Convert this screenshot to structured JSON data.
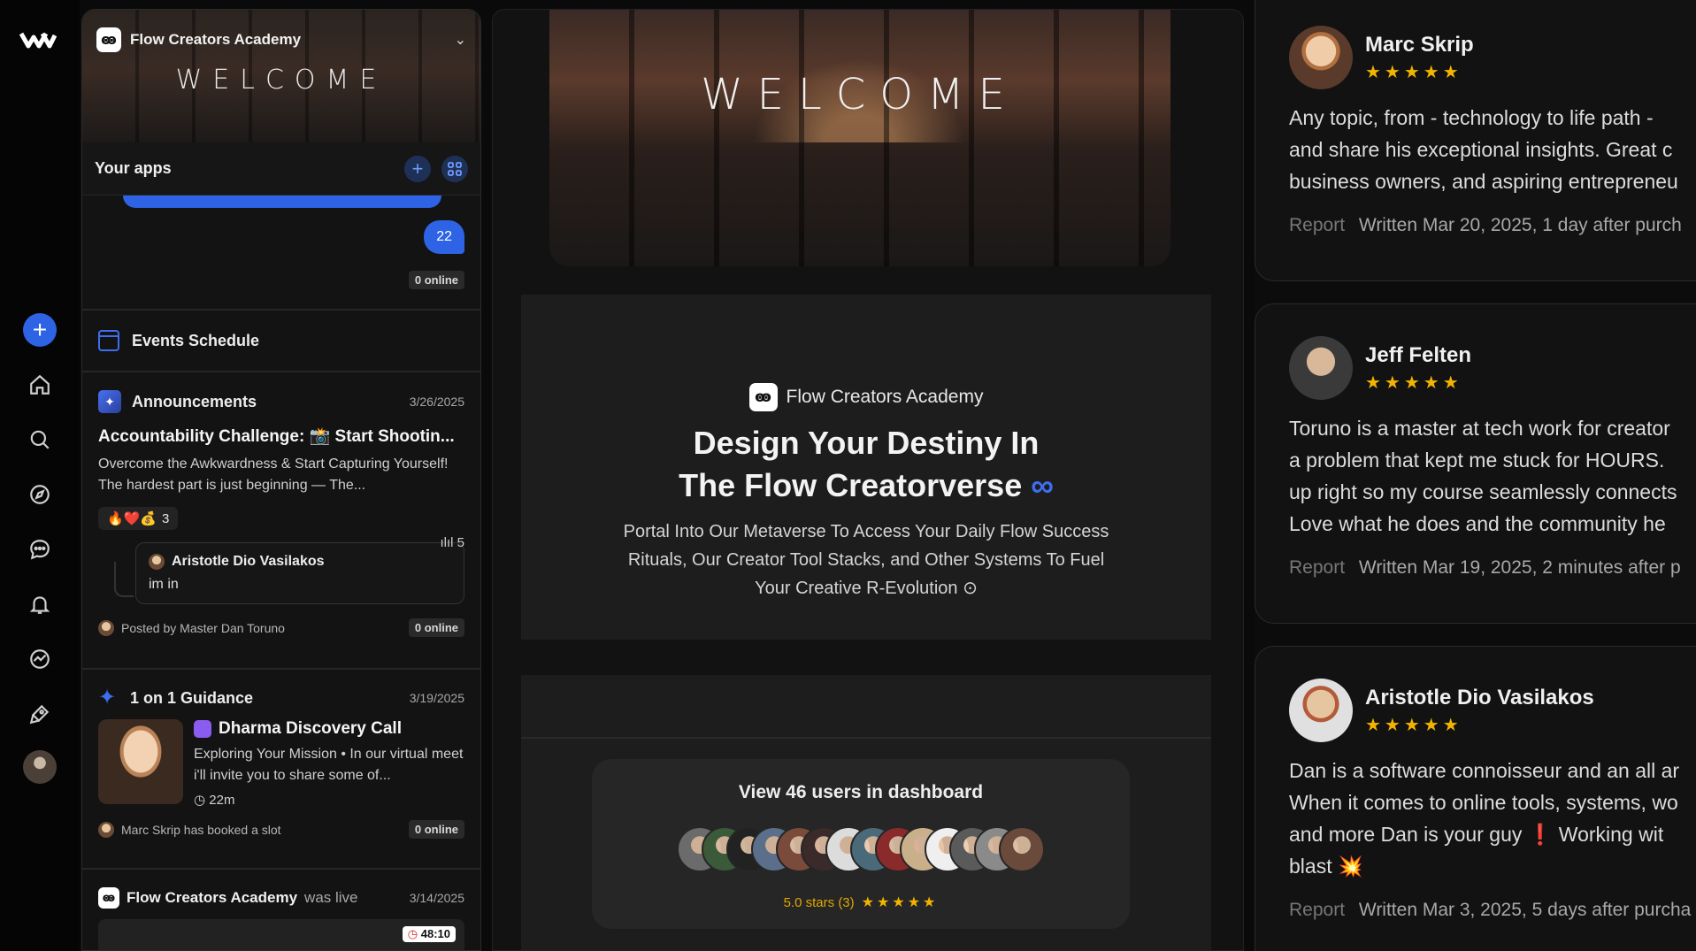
{
  "sidebar": {
    "community_name": "Flow Creators Academy",
    "banner_text": "WELCOME",
    "your_apps_title": "Your apps",
    "chat": {
      "bubble_count": "22",
      "online": "0 online"
    },
    "events_label": "Events Schedule",
    "announcement": {
      "channel": "Announcements",
      "date": "3/26/2025",
      "title": "Accountability Challenge: 📸 Start Shootin...",
      "body": "Overcome the Awkwardness & Start Capturing Yourself! The hardest part is just beginning — The...",
      "reactions": "🔥❤️💰",
      "reaction_count": "3",
      "views": "5",
      "reply_author": "Aristotle Dio Vasilakos",
      "reply_text": "im in",
      "posted_by": "Posted by Master Dan Toruno",
      "online": "0 online"
    },
    "guidance": {
      "channel": "1 on 1 Guidance",
      "date": "3/19/2025",
      "title": "Dharma Discovery Call",
      "desc": "Exploring Your Mission • In our virtual meet i'll invite you to share some of...",
      "duration": "22m",
      "booked": "Marc Skrip has booked a slot",
      "online": "0 online"
    },
    "live": {
      "name": "Flow Creators Academy",
      "was_live": "was live",
      "date": "3/14/2025",
      "timer": "48:10"
    }
  },
  "hero": {
    "welcome": "WELCOME"
  },
  "intro": {
    "brand": "Flow Creators Academy",
    "title_line1": "Design Your Destiny In",
    "title_line2": "The Flow Creatorverse",
    "subtitle": "Portal Into Our Metaverse To Access Your Daily Flow Success Rituals, Our Creator Tool Stacks, and Other Systems To Fuel Your Creative R-Evolution ⊙"
  },
  "dashboard": {
    "view_users": "View 46 users in dashboard",
    "rating": "5.0 stars (3)",
    "stars": "★★★★★",
    "avatar_colors": [
      "#6b6b6b",
      "#3a5a3a",
      "#222222",
      "#5b6f8a",
      "#7a4a3a",
      "#3a2a2a",
      "#dcdcdc",
      "#4a6a7a",
      "#8a2a2a",
      "#c9b08a",
      "#efefef",
      "#5a5a5a",
      "#8a8a8a",
      "#6a4a3a"
    ]
  },
  "reviews": [
    {
      "name": "Marc Skrip",
      "stars": "★★★★★",
      "lines": [
        "Any topic, from - technology to life path -",
        "and share his exceptional insights. Great c",
        "business owners, and aspiring entrepreneu"
      ],
      "report": "Report",
      "written": "Written Mar 20, 2025, 1 day after purch"
    },
    {
      "name": "Jeff Felten",
      "stars": "★★★★★",
      "lines": [
        "Toruno is a master at tech work for creator",
        "a problem that kept me stuck for HOURS.",
        "up right so my course seamlessly connects",
        "Love what he does and the community he"
      ],
      "report": "Report",
      "written": "Written Mar 19, 2025, 2 minutes after p"
    },
    {
      "name": "Aristotle Dio Vasilakos",
      "stars": "★★★★★",
      "lines": [
        "Dan is a software connoisseur and an all ar",
        "When it comes to online tools, systems, wo",
        "and more Dan is your guy ❗ Working wit",
        "blast 💥"
      ],
      "report": "Report",
      "written": "Written Mar 3, 2025, 5 days after purcha"
    }
  ]
}
